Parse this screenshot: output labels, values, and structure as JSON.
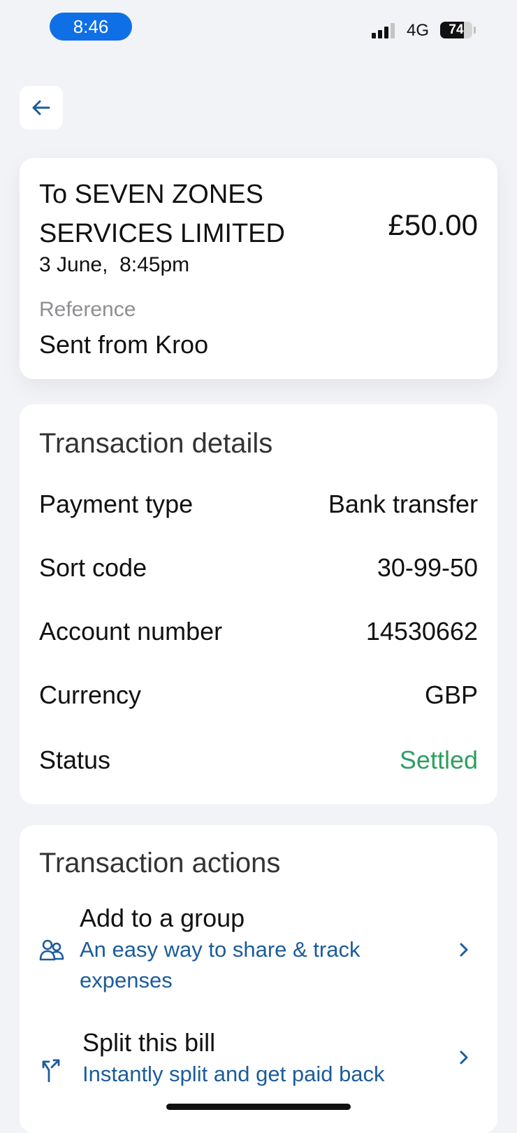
{
  "status_bar": {
    "time": "8:46",
    "network": "4G",
    "battery_percent": "74",
    "battery_level": 0.74,
    "signal_bars": 3
  },
  "nav": {
    "back_icon": "arrow-left-icon"
  },
  "summary": {
    "payee": "To SEVEN ZONES SERVICES LIMITED",
    "amount": "£50.00",
    "datetime": "3 June,  8:45pm",
    "reference_label": "Reference",
    "reference_value": "Sent from Kroo"
  },
  "details": {
    "title": "Transaction details",
    "rows": [
      {
        "label": "Payment type",
        "value": "Bank transfer"
      },
      {
        "label": "Sort code",
        "value": "30-99-50"
      },
      {
        "label": "Account number",
        "value": "14530662"
      },
      {
        "label": "Currency",
        "value": "GBP"
      },
      {
        "label": "Status",
        "value": "Settled"
      }
    ],
    "status_color": "#2f9e62"
  },
  "actions": {
    "title": "Transaction actions",
    "items": [
      {
        "title": "Add to a group",
        "subtitle": "An easy way to share & track expenses",
        "icon": "group-icon"
      },
      {
        "title": "Split this bill",
        "subtitle": "Instantly split and get paid back",
        "icon": "split-icon"
      }
    ],
    "accent_color": "#1c5c9a"
  }
}
